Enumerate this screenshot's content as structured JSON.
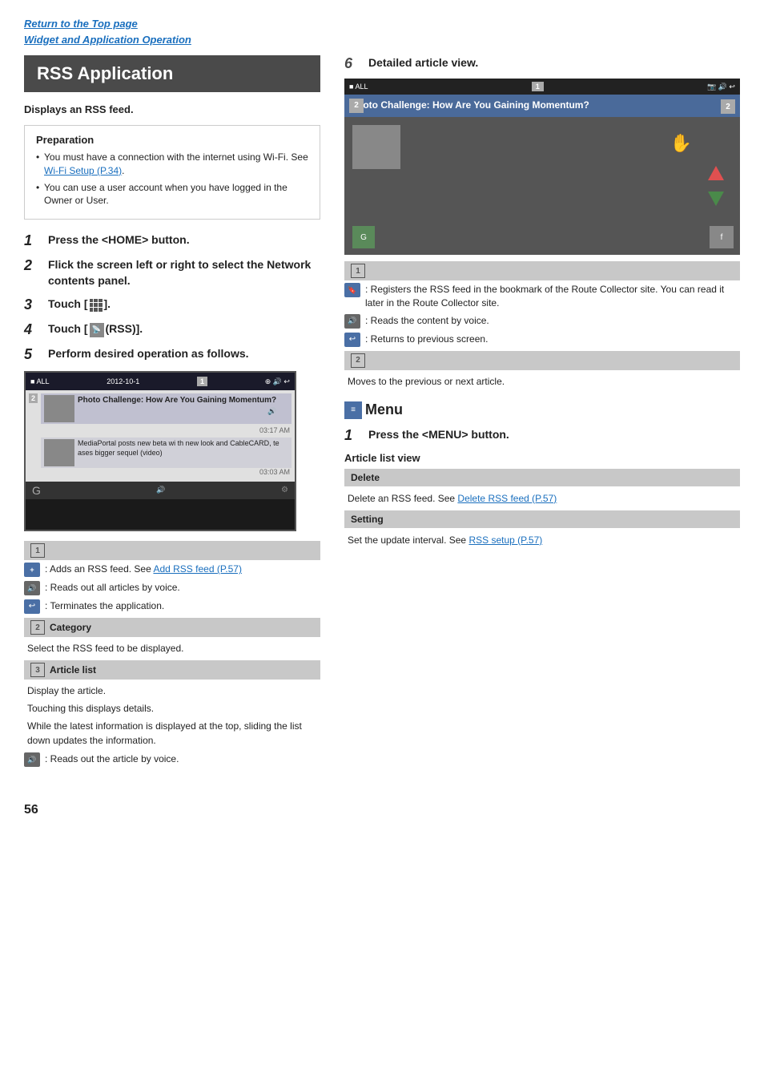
{
  "breadcrumb": {
    "link1": "Return to the Top page",
    "link2": "Widget and Application Operation"
  },
  "title": "RSS Application",
  "subtitle": "Displays an RSS feed.",
  "preparation": {
    "heading": "Preparation",
    "items": [
      "You must have a connection with the internet using Wi-Fi. See Wi-Fi Setup (P.34).",
      "You can use a user account when you have logged in the Owner or User."
    ],
    "wifi_link": "Wi-Fi Setup (P.34)"
  },
  "steps": [
    {
      "num": "1",
      "text": "Press the <HOME> button."
    },
    {
      "num": "2",
      "text": "Flick the screen left or right to select the Network contents panel."
    },
    {
      "num": "3",
      "text": "Touch [  ]."
    },
    {
      "num": "4",
      "text": "Touch [  (RSS)]."
    },
    {
      "num": "5",
      "text": "Perform desired operation as follows."
    }
  ],
  "section1": {
    "badge": "1",
    "icons": [
      {
        "type": "add",
        "text": "Adds an RSS feed. See Add RSS feed (P.57)",
        "link": "Add RSS feed (P.57)"
      },
      {
        "type": "voice",
        "text": "Reads out all articles by voice."
      },
      {
        "type": "back",
        "text": "Terminates the application."
      }
    ]
  },
  "section2": {
    "badge": "2",
    "label": "Category",
    "text": "Select the RSS feed to be displayed."
  },
  "section3": {
    "badge": "3",
    "label": "Article list",
    "items": [
      "Display the article.",
      "Touching this displays details.",
      "While the latest information is displayed at the top, sliding the list down updates the information."
    ],
    "icon_text": "Reads out the article by voice."
  },
  "right_col": {
    "step6_label": "6",
    "step6_text": "Detailed article view.",
    "section1_badge": "1",
    "section1_icons": [
      {
        "type": "bookmark",
        "text": "Registers the RSS feed in the bookmark of the Route Collector site. You can read it later in the Route Collector site."
      },
      {
        "type": "voice",
        "text": "Reads the content by voice."
      },
      {
        "type": "back",
        "text": "Returns to previous screen."
      }
    ],
    "section2_badge": "2",
    "section2_text": "Moves to the previous or next article.",
    "menu_heading": "Menu",
    "menu_step1_num": "1",
    "menu_step1_text": "Press the <MENU> button.",
    "article_list_view": "Article list view",
    "delete_heading": "Delete",
    "delete_text": "Delete an RSS feed. See Delete RSS feed (P.57)",
    "delete_link": "Delete RSS feed (P.57)",
    "setting_heading": "Setting",
    "setting_text": "Set the update interval. See RSS setup (P.57)",
    "setting_link": "RSS setup (P.57)"
  },
  "page_number": "56"
}
